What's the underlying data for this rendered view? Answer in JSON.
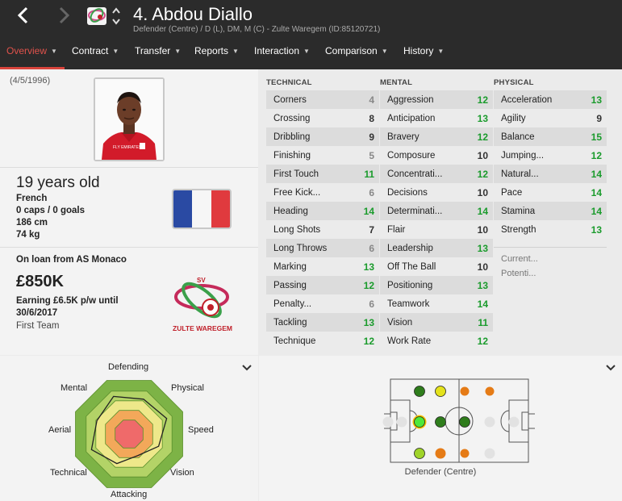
{
  "header": {
    "name": "4. Abdou Diallo",
    "subtitle": "Defender (Centre) / D (L), DM, M (C) - Zulte Waregem (ID:85120721)",
    "back_icon": "chevron-left-icon",
    "forward_icon": "chevron-right-icon"
  },
  "tabs": [
    {
      "label": "Overview",
      "active": true
    },
    {
      "label": "Contract"
    },
    {
      "label": "Transfer"
    },
    {
      "label": "Reports"
    },
    {
      "label": "Interaction"
    },
    {
      "label": "Comparison"
    },
    {
      "label": "History"
    }
  ],
  "profile": {
    "dob": "(4/5/1996)",
    "age": "19 years old",
    "nationality": "French",
    "caps": "0 caps / 0 goals",
    "height": "186 cm",
    "weight": "74 kg",
    "loan": "On loan from AS Monaco",
    "value": "£850K",
    "earning_line1": "Earning £6.5K p/w until",
    "earning_line2": "30/6/2017",
    "squad": "First Team",
    "club_logo_text": "ZULTE WAREGEM",
    "club_logo_sv": "SV",
    "shirt_sponsor": "FLY EMIRATES"
  },
  "attributes": {
    "technical": {
      "heading": "TECHNICAL",
      "rows": [
        {
          "name": "Corners",
          "value": "4"
        },
        {
          "name": "Crossing",
          "value": "8"
        },
        {
          "name": "Dribbling",
          "value": "9"
        },
        {
          "name": "Finishing",
          "value": "5"
        },
        {
          "name": "First Touch",
          "value": "11"
        },
        {
          "name": "Free Kick...",
          "value": "6"
        },
        {
          "name": "Heading",
          "value": "14"
        },
        {
          "name": "Long Shots",
          "value": "7"
        },
        {
          "name": "Long Throws",
          "value": "6"
        },
        {
          "name": "Marking",
          "value": "13"
        },
        {
          "name": "Passing",
          "value": "12"
        },
        {
          "name": "Penalty...",
          "value": "6"
        },
        {
          "name": "Tackling",
          "value": "13"
        },
        {
          "name": "Technique",
          "value": "12"
        }
      ]
    },
    "mental": {
      "heading": "MENTAL",
      "rows": [
        {
          "name": "Aggression",
          "value": "12"
        },
        {
          "name": "Anticipation",
          "value": "13"
        },
        {
          "name": "Bravery",
          "value": "12"
        },
        {
          "name": "Composure",
          "value": "10"
        },
        {
          "name": "Concentrati...",
          "value": "12"
        },
        {
          "name": "Decisions",
          "value": "10"
        },
        {
          "name": "Determinati...",
          "value": "14"
        },
        {
          "name": "Flair",
          "value": "10"
        },
        {
          "name": "Leadership",
          "value": "13"
        },
        {
          "name": "Off The Ball",
          "value": "10"
        },
        {
          "name": "Positioning",
          "value": "13"
        },
        {
          "name": "Teamwork",
          "value": "14"
        },
        {
          "name": "Vision",
          "value": "11"
        },
        {
          "name": "Work Rate",
          "value": "12"
        }
      ]
    },
    "physical": {
      "heading": "PHYSICAL",
      "rows": [
        {
          "name": "Acceleration",
          "value": "13"
        },
        {
          "name": "Agility",
          "value": "9"
        },
        {
          "name": "Balance",
          "value": "15"
        },
        {
          "name": "Jumping...",
          "value": "12"
        },
        {
          "name": "Natural...",
          "value": "14"
        },
        {
          "name": "Pace",
          "value": "14"
        },
        {
          "name": "Stamina",
          "value": "14"
        },
        {
          "name": "Strength",
          "value": "13"
        }
      ],
      "current_label": "Current...",
      "potential_label": "Potenti..."
    }
  },
  "radar": {
    "labels": [
      "Defending",
      "Physical",
      "Speed",
      "Vision",
      "Attacking",
      "Technical",
      "Aerial",
      "Mental"
    ],
    "values": [
      14,
      13,
      14,
      11,
      8,
      11,
      14,
      12
    ]
  },
  "pitch": {
    "caption": "Defender (Centre)"
  },
  "colors": {
    "accent": "#d9443c",
    "header_bg": "#2b2b2b",
    "attr_green": "#1a9b2c"
  }
}
